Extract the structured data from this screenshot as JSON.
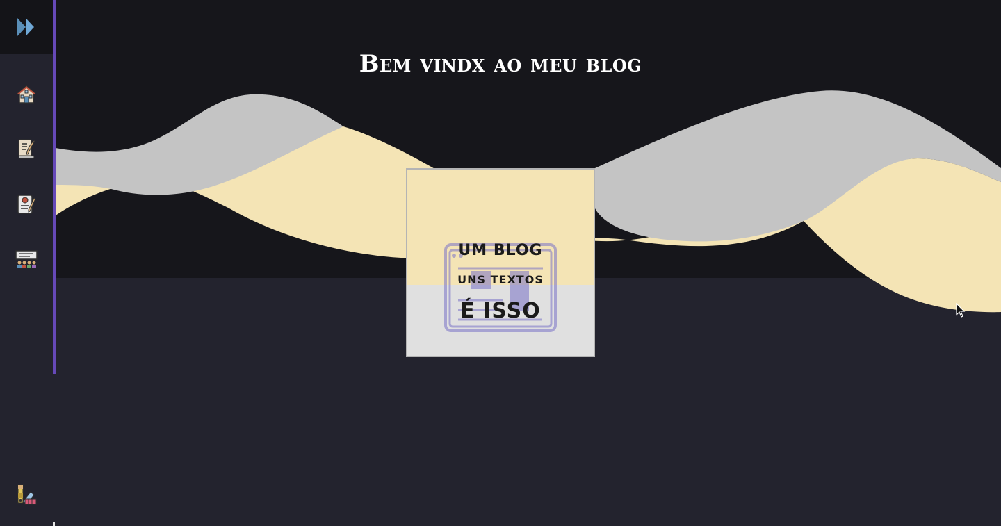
{
  "sidebar": {
    "logo_icon": "double-chevron-right-icon",
    "items": [
      {
        "icon": "house-icon"
      },
      {
        "icon": "scroll-quill-icon"
      },
      {
        "icon": "resume-document-icon"
      },
      {
        "icon": "audience-presentation-icon"
      }
    ],
    "footer_icon": "color-palette-icon",
    "accent_color": "#6649b8"
  },
  "hero": {
    "title": "Bem vindx ao meu blog"
  },
  "card": {
    "line1": "UM BLOG",
    "line2": "UNS TEXTOS",
    "line3": "É ISSO",
    "watermark_icon": "browser-article-icon"
  },
  "colors": {
    "background": "#23232e",
    "top_band": "#16161b",
    "wave_gray": "#c4c4c4",
    "wave_cream": "#f4e4b5",
    "accent": "#6649b8"
  }
}
